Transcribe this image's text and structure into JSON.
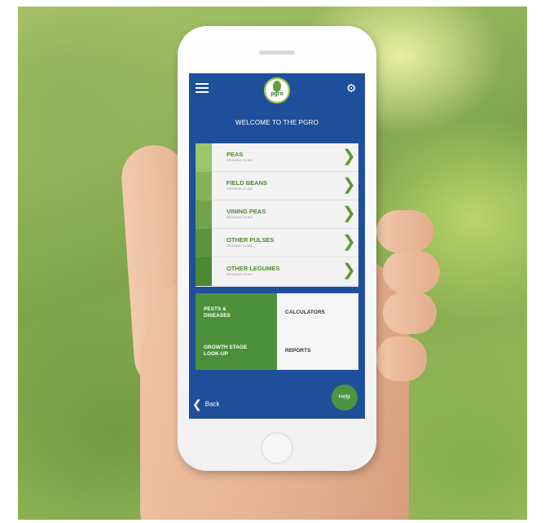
{
  "header": {
    "logo_text": "pgro",
    "welcome": "WELCOME TO THE PGRO"
  },
  "crops": [
    {
      "title": "PEAS",
      "subtitle": "GROWING GUIDE",
      "bar_color": "#9cc46a"
    },
    {
      "title": "FIELD BEANS",
      "subtitle": "GROWING GUIDE",
      "bar_color": "#84b45a"
    },
    {
      "title": "VINING PEAS",
      "subtitle": "GROWING GUIDE",
      "bar_color": "#6fa44b"
    },
    {
      "title": "OTHER PULSES",
      "subtitle": "GROWING GUIDE",
      "bar_color": "#5a943d"
    },
    {
      "title": "OTHER LEGUMES",
      "subtitle": "GROWING GUIDE",
      "bar_color": "#4a8a32"
    }
  ],
  "tiles": {
    "pests": "PESTS &\nDISEASES",
    "calculators": "CALCULATORS",
    "growth": "GROWTH STAGE\nLOOK-UP",
    "reports": "REPORTS"
  },
  "footer": {
    "back_label": "Back",
    "help_label": "Help"
  },
  "icons": {
    "menu": "menu-icon",
    "settings": "gear-icon",
    "chevron": "chevron-right-icon",
    "back": "chevron-left-icon"
  },
  "colors": {
    "screen_bg": "#1f4f9a",
    "accent_green": "#4b8f39"
  }
}
